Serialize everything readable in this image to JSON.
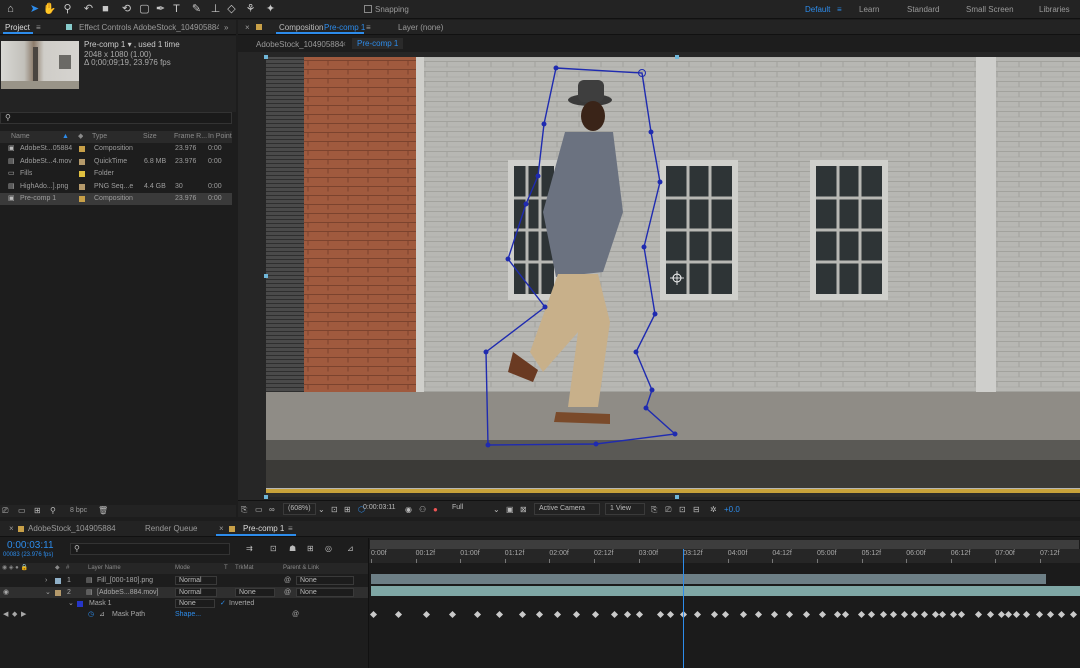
{
  "toolbar": {
    "snapping_label": "Snapping",
    "workspaces": [
      "Default",
      "Learn",
      "Standard",
      "Small Screen",
      "Libraries"
    ],
    "active_workspace": "Default",
    "tools": [
      "home-icon",
      "selection-tool-icon",
      "hand-tool-icon",
      "zoom-tool-icon",
      "rotate-tool-icon",
      "camera-tool-icon",
      "pan-behind-icon",
      "rectangle-tool-icon",
      "pen-tool-icon",
      "type-tool-icon",
      "brush-tool-icon",
      "clone-stamp-icon",
      "eraser-icon",
      "roto-brush-icon",
      "puppet-tool-icon"
    ]
  },
  "project_panel": {
    "tab_project": "Project",
    "tab_effect_controls": "Effect Controls AdobeStock_104905884.",
    "preview_name": "Pre-comp 1",
    "preview_used": ", used 1 time",
    "preview_dims": "2048 x 1080 (1.00)",
    "preview_duration": "Δ 0;00;09;19, 23.976 fps",
    "columns": {
      "name": "Name",
      "type": "Type",
      "size": "Size",
      "frame_rate": "Frame R...",
      "in_point": "In Point"
    },
    "items": [
      {
        "name": "AdobeSt...05884",
        "color": "#c8a048",
        "type": "Composition",
        "size": "",
        "fps": "23.976",
        "in": "0:00"
      },
      {
        "name": "AdobeSt...4.mov",
        "color": "#b59a6b",
        "type": "QuickTime",
        "size": "6.8 MB",
        "fps": "23.976",
        "in": "0:00"
      },
      {
        "name": "Fills",
        "color": "#e0c040",
        "type": "Folder",
        "size": "",
        "fps": "",
        "in": ""
      },
      {
        "name": "HighAdo...].png",
        "color": "#b59a6b",
        "type": "PNG Seq...e",
        "size": "4.4 GB",
        "fps": "30",
        "in": "0:00"
      },
      {
        "name": "Pre-comp 1",
        "color": "#c8a048",
        "type": "Composition",
        "size": "",
        "fps": "23.976",
        "in": "0:00"
      }
    ],
    "bpc": "8 bpc"
  },
  "comp_panel": {
    "tab_composition": "Composition",
    "comp_name": "Pre-comp 1",
    "tab_layer": "Layer (none)",
    "breadcrumb_parent": "AdobeStock_104905884",
    "breadcrumb_current": "Pre-comp 1",
    "zoom": "(608%)",
    "timecode": "0:00:03:11",
    "resolution": "Full",
    "camera": "Active Camera",
    "views": "1 View",
    "exposure": "+0.0"
  },
  "timeline": {
    "tabs": [
      "AdobeStock_104905884",
      "Render Queue",
      "Pre-comp 1"
    ],
    "active_tab": "Pre-comp 1",
    "current_time": "0:00:03:11",
    "frames_info": "00083 (23.976 fps)",
    "columns": {
      "layer_name": "Layer Name",
      "mode": "Mode",
      "t": "T",
      "trkmat": "TrkMat",
      "parent": "Parent & Link"
    },
    "ruler_labels": [
      "0:00f",
      "00:12f",
      "01:00f",
      "01:12f",
      "02:00f",
      "02:12f",
      "03:00f",
      "03:12f",
      "04:00f",
      "04:12f",
      "05:00f",
      "05:12f",
      "06:00f",
      "06:12f",
      "07:00f",
      "07:12f"
    ],
    "layers": [
      {
        "num": "1",
        "name": "Fill_[000-180].png",
        "mode": "Normal",
        "trkmat": "",
        "parent": "None",
        "color": "#8fb0c8"
      },
      {
        "num": "2",
        "name": "[AdobeS...884.mov]",
        "mode": "Normal",
        "trkmat": "None",
        "parent": "None",
        "color": "#b59a6b"
      }
    ],
    "mask": {
      "name": "Mask 1",
      "mode": "None",
      "inverted_label": "Inverted"
    },
    "mask_path": {
      "name": "Mask Path",
      "value": "Shape..."
    },
    "playhead_fraction": 0.441,
    "keyframe_fractions": [
      0,
      0.035,
      0.076,
      0.112,
      0.148,
      0.179,
      0.212,
      0.236,
      0.262,
      0.289,
      0.316,
      0.343,
      0.361,
      0.379,
      0.408,
      0.423,
      0.441,
      0.461,
      0.485,
      0.5,
      0.527,
      0.548,
      0.571,
      0.592,
      0.616,
      0.638,
      0.66,
      0.672,
      0.694,
      0.708,
      0.726,
      0.739,
      0.755,
      0.769,
      0.784,
      0.8,
      0.81,
      0.825,
      0.837,
      0.86,
      0.877,
      0.893,
      0.903,
      0.915,
      0.929,
      0.948,
      0.963,
      0.978,
      0.996
    ]
  }
}
